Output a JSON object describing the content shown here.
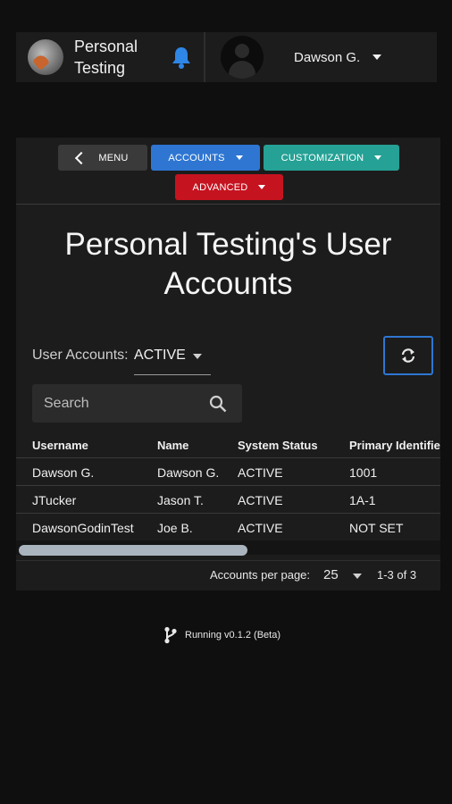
{
  "header": {
    "org_name": "Personal Testing",
    "user_name": "Dawson G."
  },
  "nav": {
    "menu_label": "MENU",
    "accounts_label": "ACCOUNTS",
    "customization_label": "CUSTOMIZATION",
    "advanced_label": "ADVANCED"
  },
  "page": {
    "title": "Personal Testing's User Accounts"
  },
  "filter": {
    "label": "User Accounts:",
    "value": "ACTIVE"
  },
  "search": {
    "placeholder": "Search"
  },
  "table": {
    "columns": [
      "Username",
      "Name",
      "System Status",
      "Primary Identifie"
    ],
    "rows": [
      [
        "Dawson G.",
        "Dawson G.",
        "ACTIVE",
        "1001"
      ],
      [
        "JTucker",
        "Jason T.",
        "ACTIVE",
        "1A-1"
      ],
      [
        "DawsonGodinTest",
        "Joe B.",
        "ACTIVE",
        "NOT SET"
      ]
    ]
  },
  "pager": {
    "label": "Accounts per page:",
    "per_page": "25",
    "range": "1-3 of 3"
  },
  "footer": {
    "version_text": "Running v0.1.2 (Beta)"
  },
  "colors": {
    "accounts": "#2e76d2",
    "customization": "#25a195",
    "advanced": "#c51320",
    "bell": "#2e86e6"
  }
}
